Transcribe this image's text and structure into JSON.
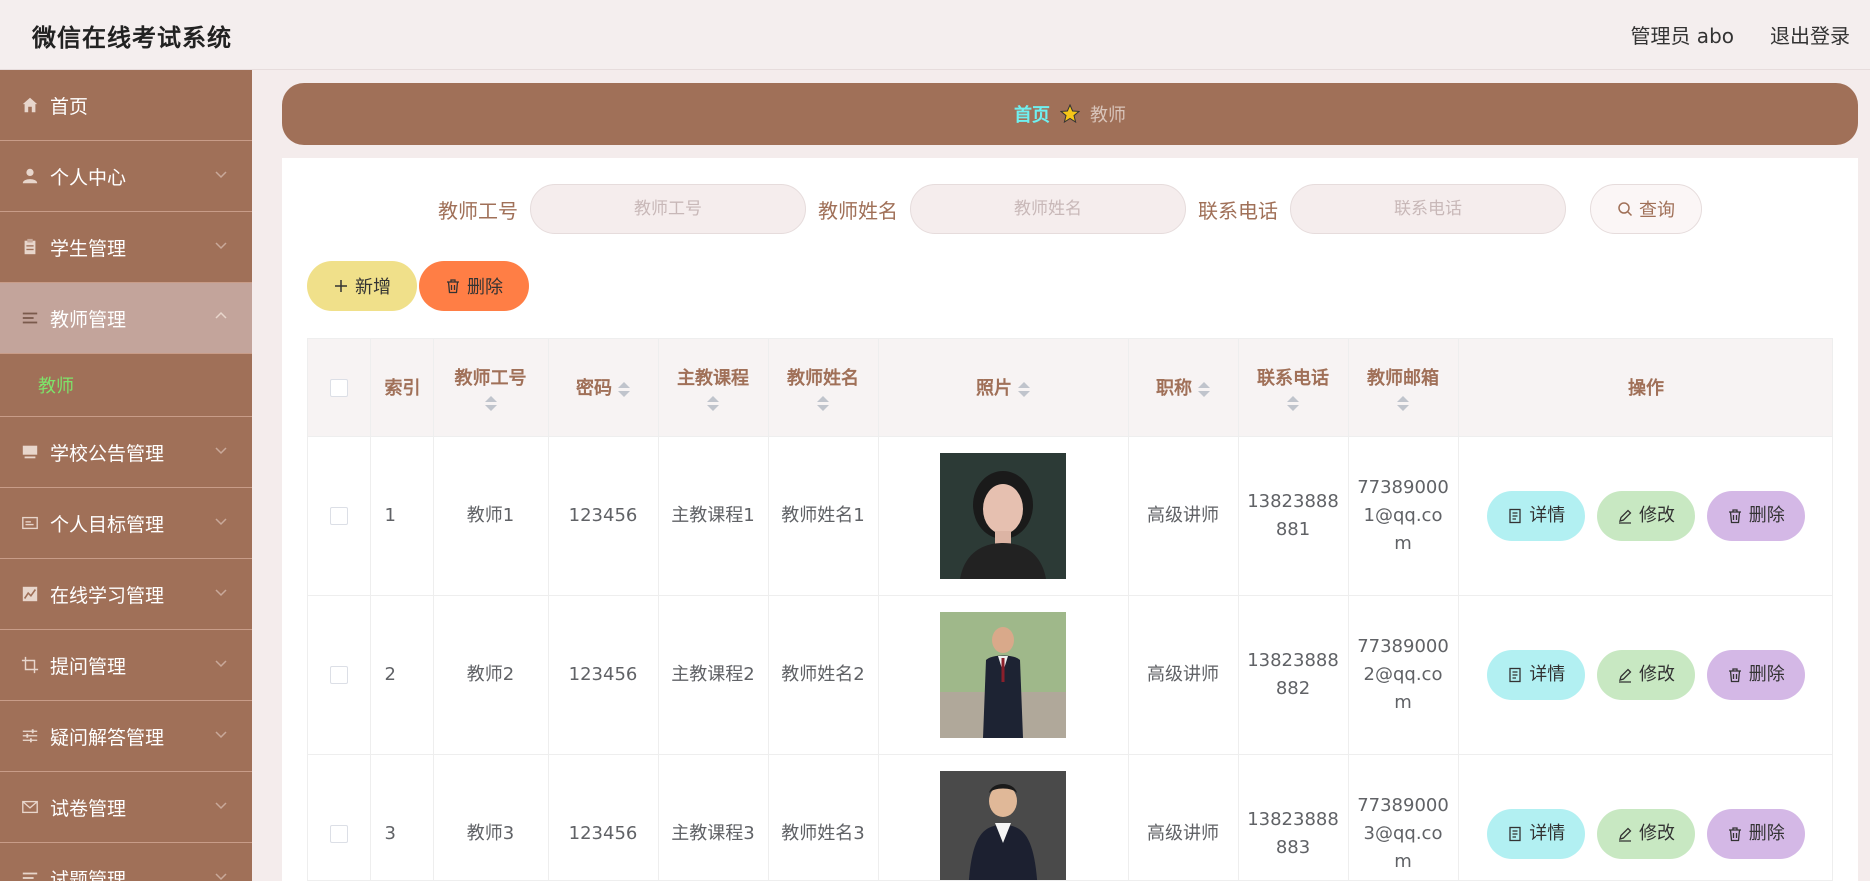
{
  "app": {
    "title": "微信在线考试系统"
  },
  "header": {
    "user_label": "管理员 abo",
    "logout_label": "退出登录"
  },
  "sidebar": {
    "items": [
      {
        "label": "首页",
        "icon": "home-icon",
        "expandable": false
      },
      {
        "label": "个人中心",
        "icon": "user-icon",
        "expandable": true
      },
      {
        "label": "学生管理",
        "icon": "clipboard-icon",
        "expandable": true
      },
      {
        "label": "教师管理",
        "icon": "list-icon",
        "expandable": true,
        "active": true
      },
      {
        "label": "学校公告管理",
        "icon": "monitor-icon",
        "expandable": true
      },
      {
        "label": "个人目标管理",
        "icon": "card-icon",
        "expandable": true
      },
      {
        "label": "在线学习管理",
        "icon": "chart-icon",
        "expandable": true
      },
      {
        "label": "提问管理",
        "icon": "crop-icon",
        "expandable": true
      },
      {
        "label": "疑问解答管理",
        "icon": "sliders-icon",
        "expandable": true
      },
      {
        "label": "试卷管理",
        "icon": "mail-icon",
        "expandable": true
      },
      {
        "label": "试题管理",
        "icon": "list-icon",
        "expandable": true
      }
    ],
    "submenu": {
      "label": "教师"
    }
  },
  "breadcrumb": {
    "home": "首页",
    "current": "教师"
  },
  "search": {
    "fields": [
      {
        "label": "教师工号",
        "placeholder": "教师工号",
        "value": ""
      },
      {
        "label": "教师姓名",
        "placeholder": "教师姓名",
        "value": ""
      },
      {
        "label": "联系电话",
        "placeholder": "联系电话",
        "value": ""
      }
    ],
    "query_label": "查询"
  },
  "actions": {
    "add_label": "新增",
    "delete_label": "删除"
  },
  "table": {
    "columns": [
      "索引",
      "教师工号",
      "密码",
      "主教课程",
      "教师姓名",
      "照片",
      "职称",
      "联系电话",
      "教师邮箱",
      "操作"
    ],
    "rows": [
      {
        "index": "1",
        "teacher_id": "教师1",
        "password": "123456",
        "course": "主教课程1",
        "name": "教师姓名1",
        "photo": "woman-portrait",
        "title": "高级讲师",
        "phone": "13823888881",
        "email": "773890001@qq.com"
      },
      {
        "index": "2",
        "teacher_id": "教师2",
        "password": "123456",
        "course": "主教课程2",
        "name": "教师姓名2",
        "photo": "man-suit-outdoor",
        "title": "高级讲师",
        "phone": "13823888882",
        "email": "773890002@qq.com"
      },
      {
        "index": "3",
        "teacher_id": "教师3",
        "password": "123456",
        "course": "主教课程3",
        "name": "教师姓名3",
        "photo": "man-suit-dark",
        "title": "高级讲师",
        "phone": "13823888883",
        "email": "773890003@qq.com"
      }
    ],
    "op_labels": {
      "detail": "详情",
      "edit": "修改",
      "delete": "删除"
    }
  },
  "colors": {
    "primary": "#a07058",
    "accent_home": "#6ff0f0",
    "sub_active": "#7ee36a"
  }
}
